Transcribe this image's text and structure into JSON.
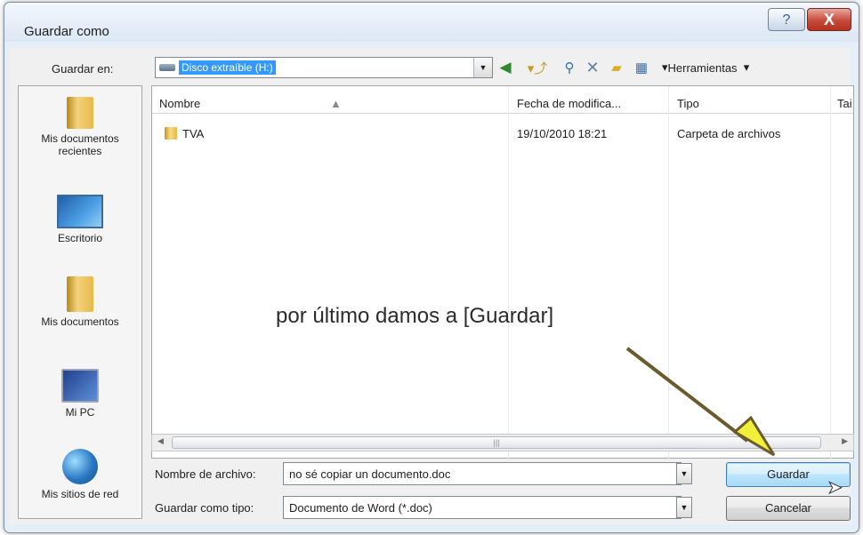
{
  "window": {
    "title": "Guardar como"
  },
  "controls": {
    "help": "?",
    "close": "X"
  },
  "top": {
    "save_in_label": "Guardar en:",
    "location": "Disco extraíble (H:)",
    "toolbar": {
      "tools": "Herramientas"
    }
  },
  "places": [
    {
      "label": "Mis documentos recientes",
      "icon": "recent-folder-icon"
    },
    {
      "label": "Escritorio",
      "icon": "desktop-icon"
    },
    {
      "label": "Mis documentos",
      "icon": "documents-folder-icon"
    },
    {
      "label": "Mi PC",
      "icon": "computer-icon"
    },
    {
      "label": "Mis sitios de red",
      "icon": "network-globe-icon"
    }
  ],
  "file_list": {
    "columns": [
      "Nombre",
      "Fecha de modifica...",
      "Tipo",
      "Tai"
    ],
    "rows": [
      {
        "name": "TVA",
        "date": "19/10/2010 18:21",
        "type": "Carpeta de archivos"
      }
    ]
  },
  "bottom": {
    "filename_label": "Nombre de archivo:",
    "filename_value": "no sé copiar un documento.doc",
    "type_label": "Guardar como tipo:",
    "type_value": "Documento de Word (*.doc)",
    "save_button": "Guardar",
    "cancel_button": "Cancelar"
  },
  "annotation": {
    "text": "por último damos a [Guardar]"
  }
}
